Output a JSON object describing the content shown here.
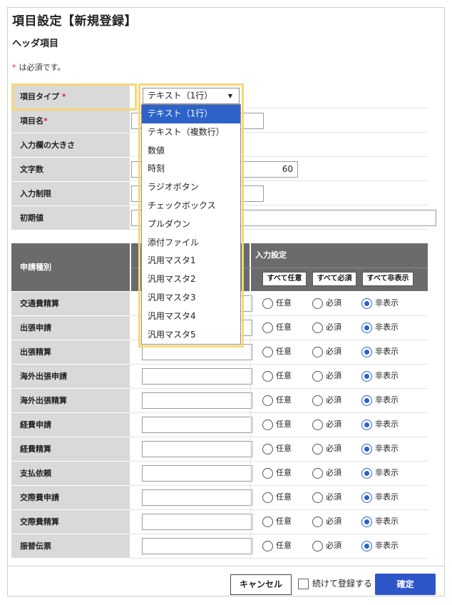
{
  "page": {
    "title": "項目設定【新規登録】",
    "section_title": "ヘッダ項目",
    "required_mark": "*",
    "required_note": "は必須です。"
  },
  "header_fields": {
    "item_type_label": "項目タイプ",
    "item_name_label": "項目名",
    "input_size_label": "入力欄の大きさ",
    "char_count_label": "文字数",
    "char_count_value": "60",
    "input_limit_label": "入力制限",
    "default_label": "初期値"
  },
  "item_type_select": {
    "selected": "テキスト（1行）",
    "options": [
      "テキスト（1行）",
      "テキスト（複数行）",
      "数値",
      "時刻",
      "ラジオボタン",
      "チェックボックス",
      "プルダウン",
      "添付ファイル",
      "汎用マスタ1",
      "汎用マスタ2",
      "汎用マスタ3",
      "汎用マスタ4",
      "汎用マスタ5"
    ],
    "highlighted_index": 0
  },
  "grid": {
    "col_type": "申請種別",
    "col_settings": "入力設定",
    "btn_all_optional": "すべて任意",
    "btn_all_required": "すべて必須",
    "btn_all_hidden": "すべて非表示",
    "radio_optional": "任意",
    "radio_required": "必須",
    "radio_hidden": "非表示",
    "rows": [
      {
        "label": "交通費精算",
        "selected": "hidden"
      },
      {
        "label": "出張申請",
        "selected": "hidden"
      },
      {
        "label": "出張精算",
        "selected": "hidden"
      },
      {
        "label": "海外出張申請",
        "selected": "hidden"
      },
      {
        "label": "海外出張精算",
        "selected": "hidden"
      },
      {
        "label": "経費申請",
        "selected": "hidden"
      },
      {
        "label": "経費精算",
        "selected": "hidden"
      },
      {
        "label": "支払依頼",
        "selected": "hidden"
      },
      {
        "label": "交際費申請",
        "selected": "hidden"
      },
      {
        "label": "交際費精算",
        "selected": "hidden"
      },
      {
        "label": "振替伝票",
        "selected": "hidden"
      }
    ]
  },
  "footer": {
    "cancel": "キャンセル",
    "continue_label": "続けて登録する",
    "confirm": "確定"
  },
  "colors": {
    "accent": "#2d63c8",
    "highlight": "#f6d776",
    "header_gray": "#6b6b6b",
    "label_gray": "#d9d9d9",
    "required": "#d9262c"
  }
}
